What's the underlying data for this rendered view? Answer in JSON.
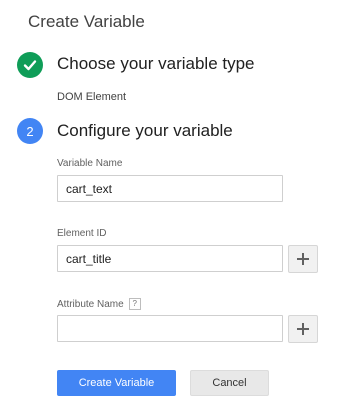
{
  "dialog": {
    "title": "Create Variable"
  },
  "step1": {
    "title": "Choose your variable type",
    "type_value": "DOM Element"
  },
  "step2": {
    "number": "2",
    "title": "Configure your variable"
  },
  "fields": {
    "variable_name": {
      "label": "Variable Name",
      "value": "cart_text"
    },
    "element_id": {
      "label": "Element ID",
      "value": "cart_title"
    },
    "attribute_name": {
      "label": "Attribute Name",
      "help": "?",
      "value": ""
    }
  },
  "buttons": {
    "create": "Create Variable",
    "cancel": "Cancel"
  },
  "colors": {
    "step_complete": "#0f9d58",
    "step_active": "#4285f4",
    "primary_button": "#4285f4"
  },
  "icons": {
    "step1": "checkmark-icon",
    "add": "plus-icon"
  }
}
